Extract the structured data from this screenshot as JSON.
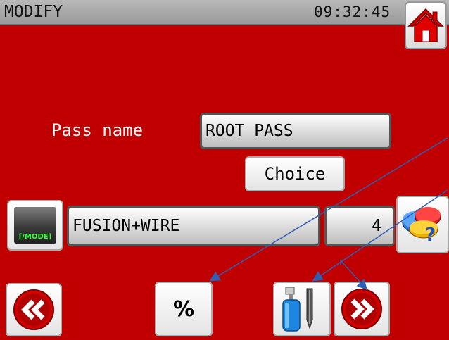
{
  "header": {
    "title": "MODIFY",
    "clock": "09:32:45"
  },
  "pass": {
    "label": "Pass name",
    "value": "ROOT PASS",
    "choice_label": "Choice"
  },
  "mode": {
    "mode_label": "[/MODE]",
    "process_value": "FUSION+WIRE",
    "number_value": "4"
  },
  "footer": {
    "percent_label": "%"
  },
  "colors": {
    "background": "#c00000",
    "header": "#a8a8a8",
    "arrow": "#2e5fb0"
  },
  "icons": [
    "home-icon",
    "help-icon",
    "previous-icon",
    "gas-wire-icon",
    "next-icon"
  ]
}
